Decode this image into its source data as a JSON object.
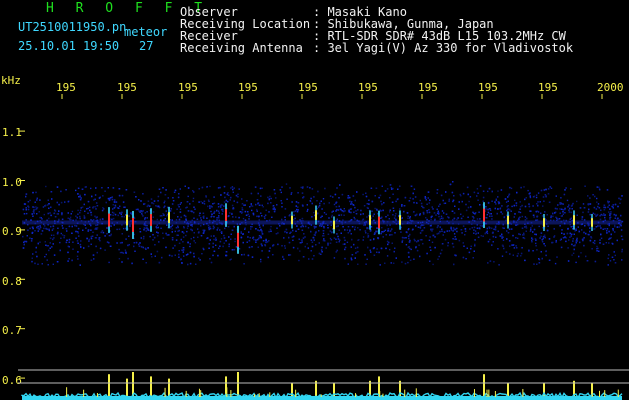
{
  "header": {
    "app_title": "H R O F F T",
    "file_name": "UT2510011950.pn",
    "meteor_label": "meteor",
    "date_time": "25.10.01 19:50",
    "meteor_count": "27",
    "info_labels": [
      "Observer",
      "Receiving Location",
      "Receiver",
      "Receiving Antenna"
    ],
    "info_values": [
      ": Masaki Kano",
      ": Shibukawa, Gunma, Japan",
      ": RTL-SDR SDR# 43dB L15 103.2MHz CW",
      ": 3el Yagi(V) Az 330 for Vladivostok"
    ]
  },
  "colors": {
    "background": "#000000",
    "title_green": "#1fe01f",
    "header_cyan": "#3fd8ff",
    "axis_yellow": "#f5f04a",
    "noise_blue": "#1b2fd0",
    "echo_red": "#ff3030",
    "baseline_cyan": "#31d6f2"
  },
  "chart_data": {
    "type": "heatmap",
    "title": "",
    "xlabel": "",
    "ylabel": "kHz",
    "x_tick_labels": [
      "195",
      "195",
      "195",
      "195",
      "195",
      "195",
      "195",
      "195",
      "195",
      "2000"
    ],
    "y_tick_labels": [
      "1.1",
      "1.0",
      "0.9",
      "0.8",
      "0.7",
      "0.6"
    ],
    "y_ticks": [
      1.1,
      1.0,
      0.9,
      0.8,
      0.7,
      0.6
    ],
    "ylim": [
      0.58,
      1.15
    ],
    "signal_band_khz": [
      0.83,
      0.99
    ],
    "signal_center_khz": 0.915,
    "grid": false,
    "meteor_echoes": [
      {
        "t": 0.145,
        "f": 0.92,
        "strength": 0.9
      },
      {
        "t": 0.175,
        "f": 0.92,
        "strength": 0.7
      },
      {
        "t": 0.185,
        "f": 0.91,
        "strength": 1.0
      },
      {
        "t": 0.215,
        "f": 0.92,
        "strength": 0.8
      },
      {
        "t": 0.245,
        "f": 0.925,
        "strength": 0.7
      },
      {
        "t": 0.34,
        "f": 0.93,
        "strength": 0.8
      },
      {
        "t": 0.36,
        "f": 0.88,
        "strength": 1.0
      },
      {
        "t": 0.45,
        "f": 0.92,
        "strength": 0.5
      },
      {
        "t": 0.49,
        "f": 0.93,
        "strength": 0.6
      },
      {
        "t": 0.52,
        "f": 0.91,
        "strength": 0.5
      },
      {
        "t": 0.58,
        "f": 0.92,
        "strength": 0.6
      },
      {
        "t": 0.595,
        "f": 0.915,
        "strength": 0.8
      },
      {
        "t": 0.63,
        "f": 0.92,
        "strength": 0.6
      },
      {
        "t": 0.77,
        "f": 0.93,
        "strength": 0.9
      },
      {
        "t": 0.81,
        "f": 0.92,
        "strength": 0.5
      },
      {
        "t": 0.87,
        "f": 0.915,
        "strength": 0.5
      },
      {
        "t": 0.92,
        "f": 0.92,
        "strength": 0.6
      },
      {
        "t": 0.95,
        "f": 0.915,
        "strength": 0.5
      }
    ]
  }
}
